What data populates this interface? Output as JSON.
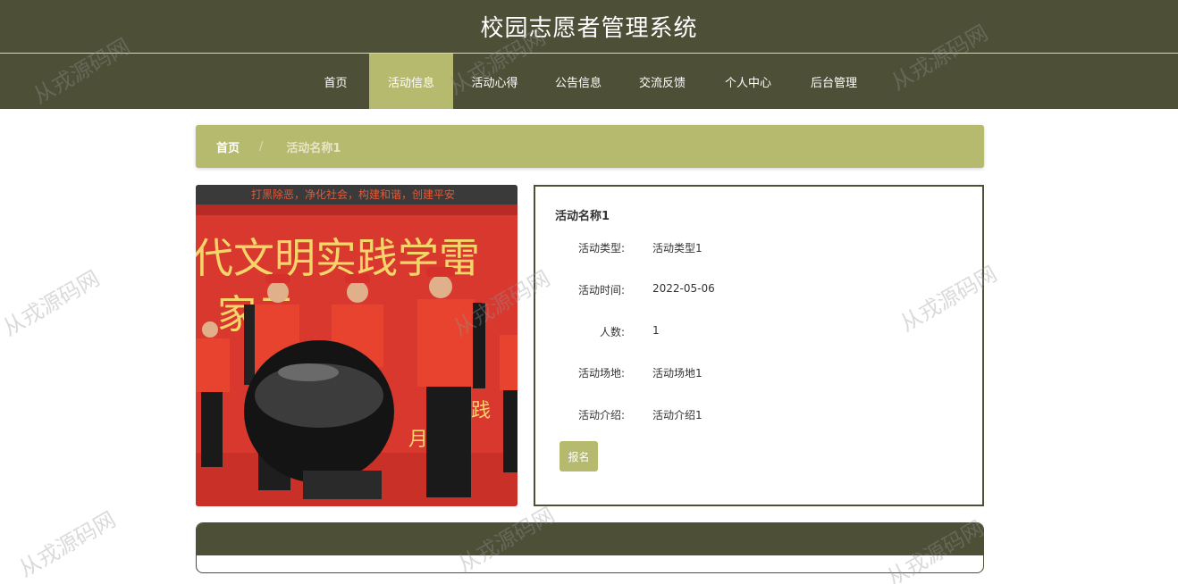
{
  "header": {
    "title": "校园志愿者管理系统"
  },
  "nav": {
    "items": [
      {
        "label": "首页"
      },
      {
        "label": "活动信息"
      },
      {
        "label": "活动心得"
      },
      {
        "label": "公告信息"
      },
      {
        "label": "交流反馈"
      },
      {
        "label": "个人中心"
      },
      {
        "label": "后台管理"
      }
    ],
    "active": "活动信息"
  },
  "breadcrumb": {
    "home": "首页",
    "separator": "/",
    "current": "活动名称1"
  },
  "photo": {
    "banner_top": "打黑除恶，净化社会，构建和谐，创建平安",
    "banner_main": "代文明实践学雷",
    "banner_second": "家云",
    "banner_small": "践",
    "banner_date": "月"
  },
  "detail": {
    "title": "活动名称1",
    "fields": [
      {
        "label": "活动类型:",
        "value": "活动类型1"
      },
      {
        "label": "活动时间:",
        "value": "2022-05-06"
      },
      {
        "label": "人数:",
        "value": "1"
      },
      {
        "label": "活动场地:",
        "value": "活动场地1"
      },
      {
        "label": "活动介绍:",
        "value": "活动介绍1"
      }
    ],
    "button": "报名"
  },
  "watermark": {
    "text": "从戎源码网"
  },
  "colors": {
    "primary": "#4e4f37",
    "accent": "#b6ba6e"
  }
}
